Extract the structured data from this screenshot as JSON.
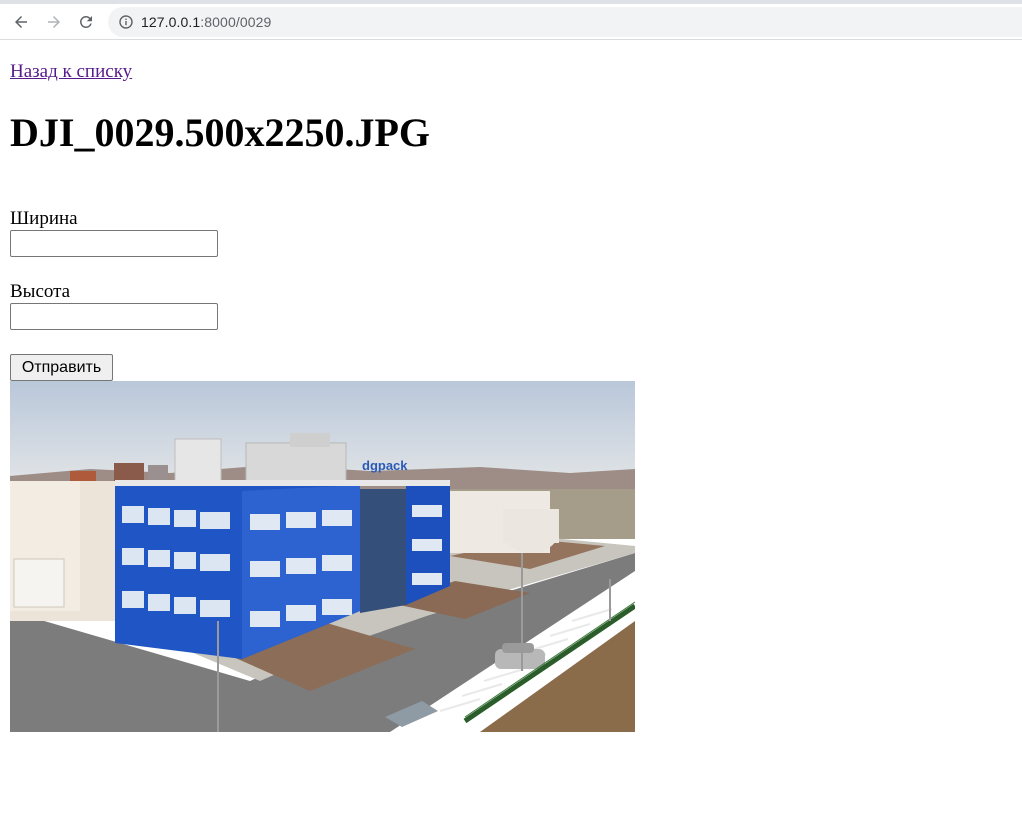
{
  "browser": {
    "url_host": "127.0.0.1",
    "url_path": ":8000/0029"
  },
  "page": {
    "back_link": "Назад к списку",
    "title": "DJI_0029.500x2250.JPG",
    "width_label": "Ширина",
    "width_value": "",
    "height_label": "Высота",
    "height_value": "",
    "submit_label": "Отправить"
  },
  "icons": {
    "back": "arrow-left-icon",
    "forward": "arrow-right-icon",
    "reload": "reload-icon",
    "site_info": "info-icon"
  },
  "colors": {
    "visited_link": "#551a8b",
    "building_blue": "#1f55c4"
  }
}
